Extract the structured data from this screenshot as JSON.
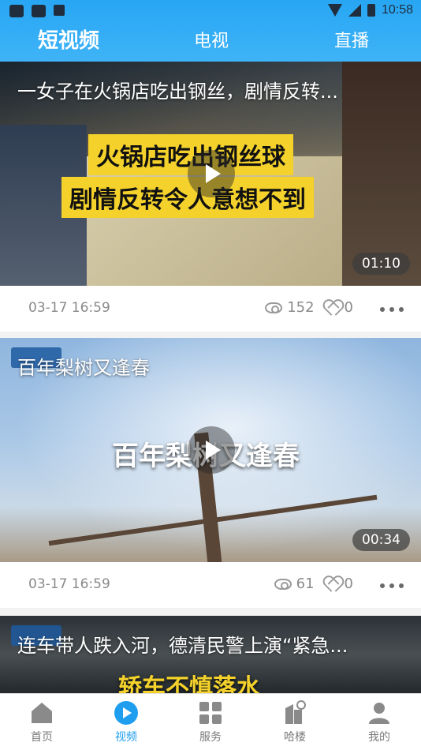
{
  "status_bar": {
    "time": "10:58"
  },
  "top_tabs": [
    {
      "label": "短视频",
      "active": true
    },
    {
      "label": "电视",
      "active": false
    },
    {
      "label": "直播",
      "active": false
    }
  ],
  "videos": [
    {
      "title": "一女子在火锅店吃出钢丝，剧情反转...",
      "caption_lines": [
        "火锅店吃出钢丝球",
        "剧情反转令人意想不到"
      ],
      "duration": "01:10",
      "date": "03-17 16:59",
      "views": "152",
      "likes": "0"
    },
    {
      "title": "百年梨树又逢春",
      "caption_lines": [
        "百年梨树又逢春"
      ],
      "duration": "00:34",
      "date": "03-17 16:59",
      "views": "61",
      "likes": "0"
    },
    {
      "title": "连车带人跌入河，德清民警上演“紧急...",
      "caption_lines": [
        "轿车不慎落水"
      ]
    }
  ],
  "bottom_nav": [
    {
      "label": "首页",
      "icon": "home-icon",
      "active": false
    },
    {
      "label": "视频",
      "icon": "video-icon",
      "active": true
    },
    {
      "label": "服务",
      "icon": "grid-icon",
      "active": false
    },
    {
      "label": "哈楼",
      "icon": "building-icon",
      "active": false
    },
    {
      "label": "我的",
      "icon": "profile-icon",
      "active": false
    }
  ],
  "colors": {
    "accent": "#1f9ef0",
    "header": "#2aa7f5"
  }
}
